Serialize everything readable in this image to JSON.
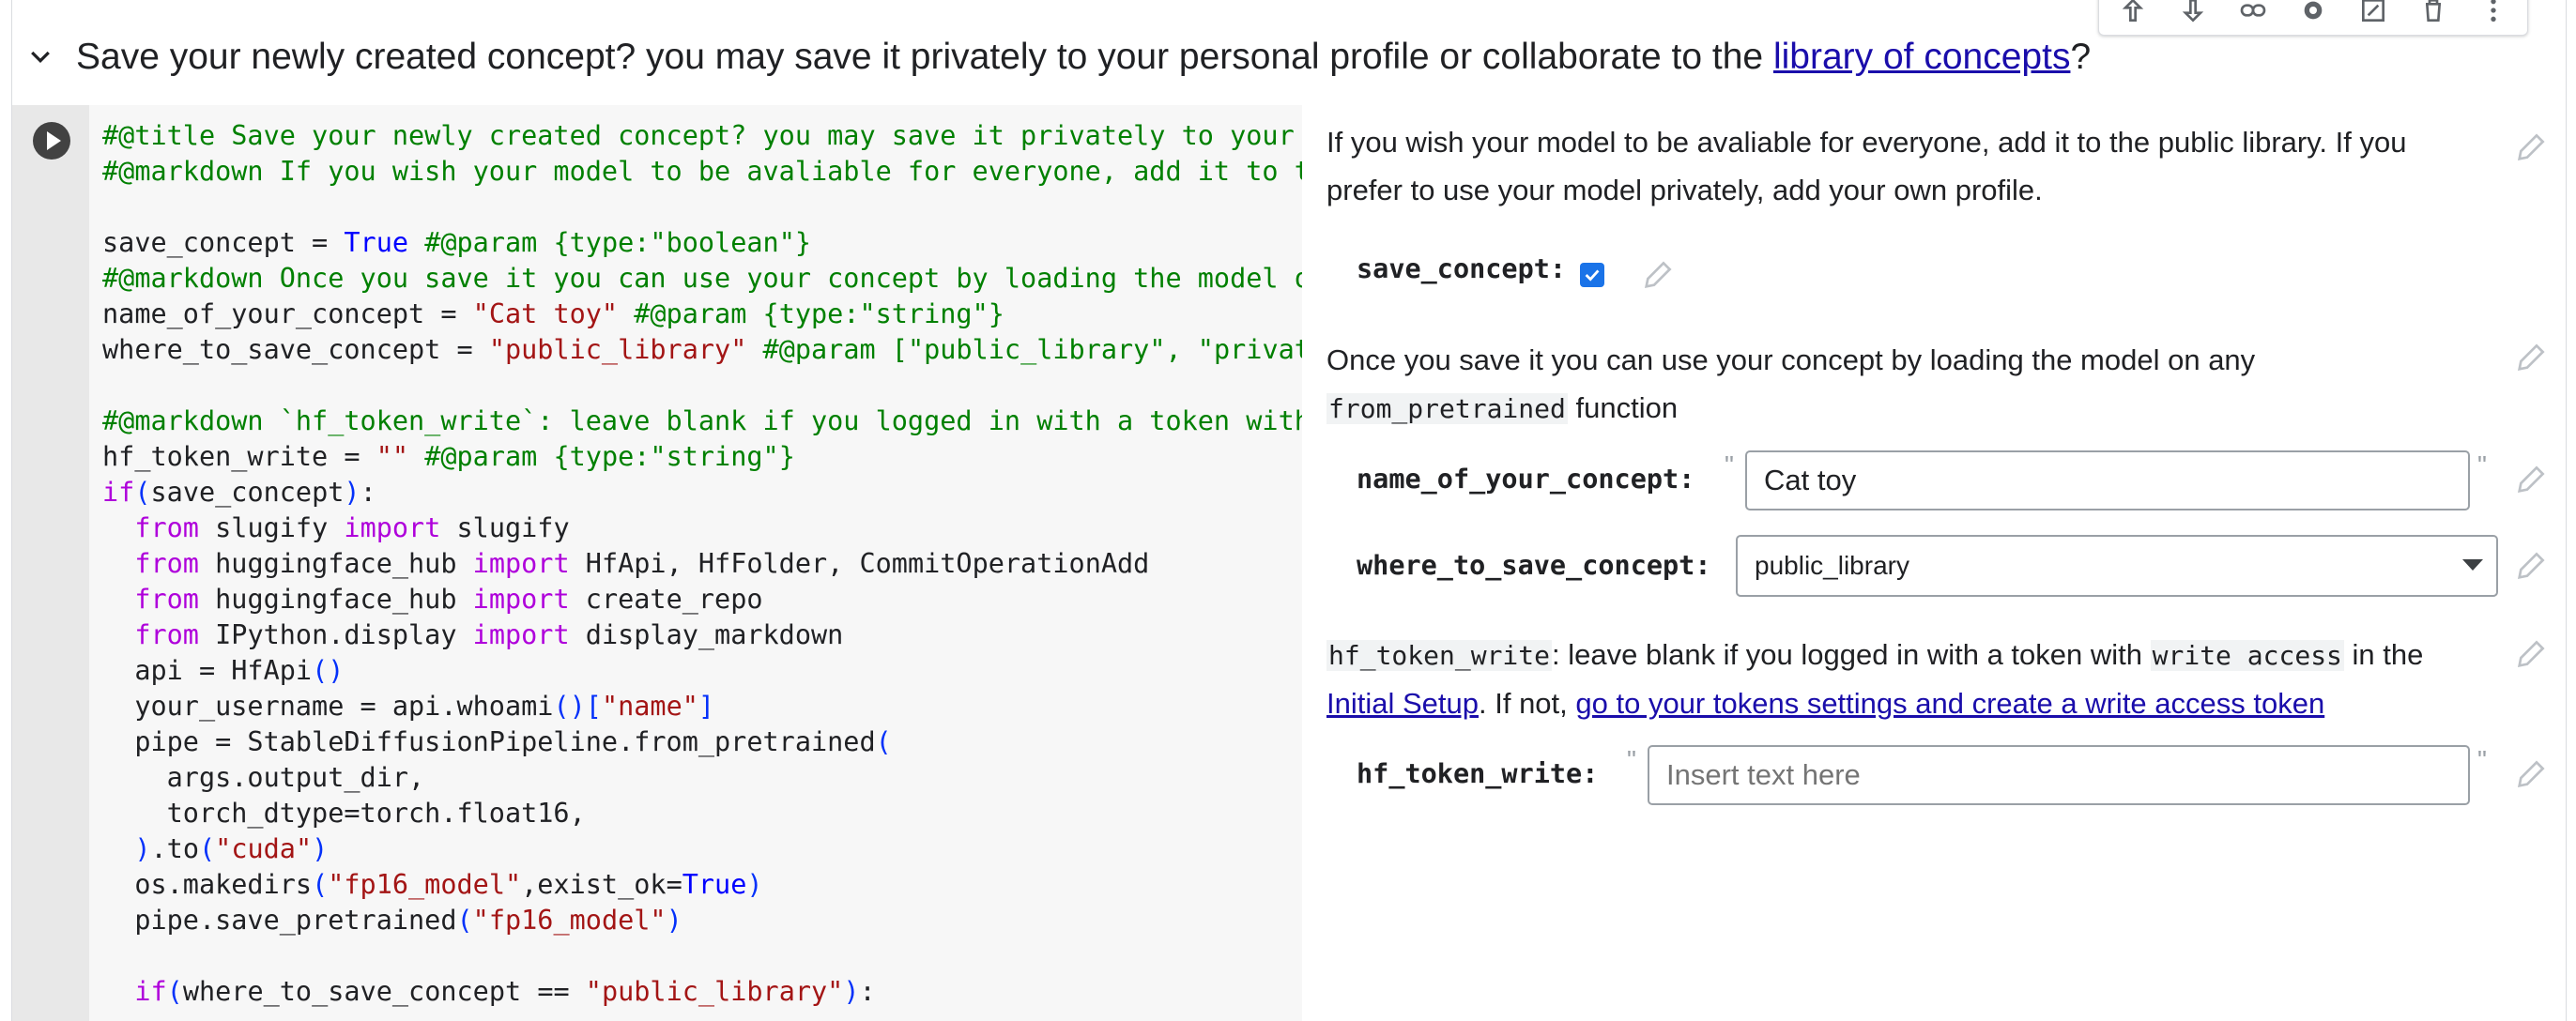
{
  "header": {
    "title_prefix": "Save your newly created concept? you may save it privately to your personal profile or collaborate to the ",
    "title_link": "library of concepts",
    "title_suffix": "?"
  },
  "toolbar": {
    "icons": [
      "move-up-icon",
      "move-down-icon",
      "link-icon",
      "settings-icon",
      "mirror-cell-icon",
      "delete-icon",
      "more-icon"
    ]
  },
  "code": {
    "lines": [
      "#@title Save your newly created concept? you may save it privately to your",
      "#@markdown If you wish your model to be avaliable for everyone, add it to t",
      "",
      "save_concept = True #@param {type:\"boolean\"}",
      "#@markdown Once you save it you can use your concept by loading the model o",
      "name_of_your_concept = \"Cat toy\" #@param {type:\"string\"}",
      "where_to_save_concept = \"public_library\" #@param [\"public_library\", \"privat",
      "",
      "#@markdown `hf_token_write`: leave blank if you logged in with a token with",
      "hf_token_write = \"\" #@param {type:\"string\"}",
      "if(save_concept):",
      "  from slugify import slugify",
      "  from huggingface_hub import HfApi, HfFolder, CommitOperationAdd",
      "  from huggingface_hub import create_repo",
      "  from IPython.display import display_markdown",
      "  api = HfApi()",
      "  your_username = api.whoami()[\"name\"]",
      "  pipe = StableDiffusionPipeline.from_pretrained(",
      "    args.output_dir,",
      "    torch_dtype=torch.float16,",
      "  ).to(\"cuda\")",
      "  os.makedirs(\"fp16_model\",exist_ok=True)",
      "  pipe.save_pretrained(\"fp16_model\")",
      "",
      "  if(where_to_save_concept == \"public_library\"):"
    ]
  },
  "form": {
    "md1": "If you wish your model to be avaliable for everyone, add it to the public library. If you prefer to use your model privately, add your own profile.",
    "save_concept": {
      "label": "save_concept:",
      "checked": true
    },
    "md2_text": "Once you save it you can use your concept by loading the model on any",
    "md2_code": "from_pretrained",
    "md2_suffix": " function",
    "name_of_your_concept": {
      "label": "name_of_your_concept:",
      "value": "Cat toy"
    },
    "where_to_save_concept": {
      "label": "where_to_save_concept:",
      "value": "public_library"
    },
    "md3": {
      "code1": "hf_token_write",
      "text1": ": leave blank if you logged in with a token with ",
      "code2": "write access",
      "text2": " in the",
      "link1": "Initial Setup",
      "text3": ". If not, ",
      "link2": "go to your tokens settings and create a write access token"
    },
    "hf_token_write": {
      "label": "hf_token_write:",
      "value": "",
      "placeholder": "Insert text here"
    },
    "quote_char": "\""
  },
  "colors": {
    "link": "#1a0dab",
    "checkbox": "#1a73e8",
    "comment": "#008000",
    "keyword": "#af00db",
    "string": "#a31515"
  }
}
